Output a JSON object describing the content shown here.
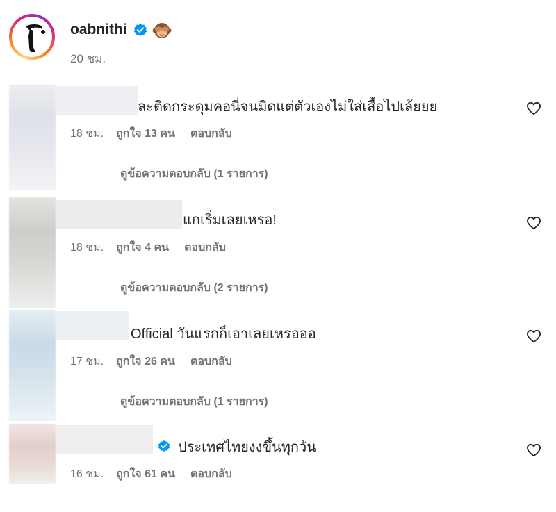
{
  "post": {
    "username": "oabnithi",
    "time": "20 ชม.",
    "icons": [
      "verified-badge-icon",
      "see-no-evil-monkey-icon"
    ]
  },
  "comments": [
    {
      "text": "ละติดกระดุมคอนี่จนมิดแต่ตัวเองไม่ใส่เสื้อไปเล้ยยย",
      "time": "18 ชม.",
      "likes": "ถูกใจ 13 คน",
      "reply": "ตอบกลับ",
      "view_replies": "ดูข้อความตอบกลับ (1 รายการ)"
    },
    {
      "text": "แกเริ่มเลยเหรอ!",
      "time": "18 ชม.",
      "likes": "ถูกใจ 4 คน",
      "reply": "ตอบกลับ",
      "view_replies": "ดูข้อความตอบกลับ (2 รายการ)"
    },
    {
      "text": "Official วันแรกก็เอาเลยเหรอออ",
      "time": "17 ชม.",
      "likes": "ถูกใจ 26 คน",
      "reply": "ตอบกลับ",
      "view_replies": "ดูข้อความตอบกลับ (1 รายการ)"
    },
    {
      "text": "ประเทศไทยงงขึ้นทุกวัน",
      "time": "16 ชม.",
      "likes": "ถูกใจ 61 คน",
      "reply": "ตอบกลับ"
    }
  ],
  "colors": {
    "text": "#262626",
    "secondary": "#737373",
    "verified": "#0095f6"
  }
}
